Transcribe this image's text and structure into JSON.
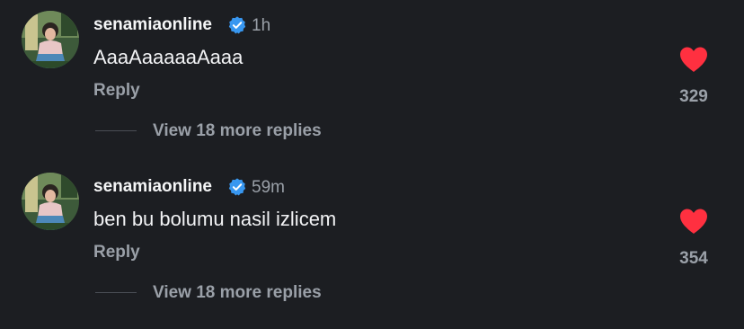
{
  "colors": {
    "background": "#1c1e22",
    "verified_badge": "#3897f0",
    "heart": "#ff3040",
    "secondary_text": "#9aa0a8"
  },
  "comments": [
    {
      "username": "senamiaonline",
      "verified": true,
      "time": "1h",
      "text": "AaaAaaaaaAaaa",
      "reply_label": "Reply",
      "likes": "329",
      "liked": true,
      "view_replies_label": "View 18 more replies"
    },
    {
      "username": "senamiaonline",
      "verified": true,
      "time": "59m",
      "text": "ben bu bolumu nasil izlicem",
      "reply_label": "Reply",
      "likes": "354",
      "liked": true,
      "view_replies_label": "View 18 more replies"
    }
  ],
  "icons": {
    "verified": "verified-badge-icon",
    "like": "heart-icon"
  }
}
